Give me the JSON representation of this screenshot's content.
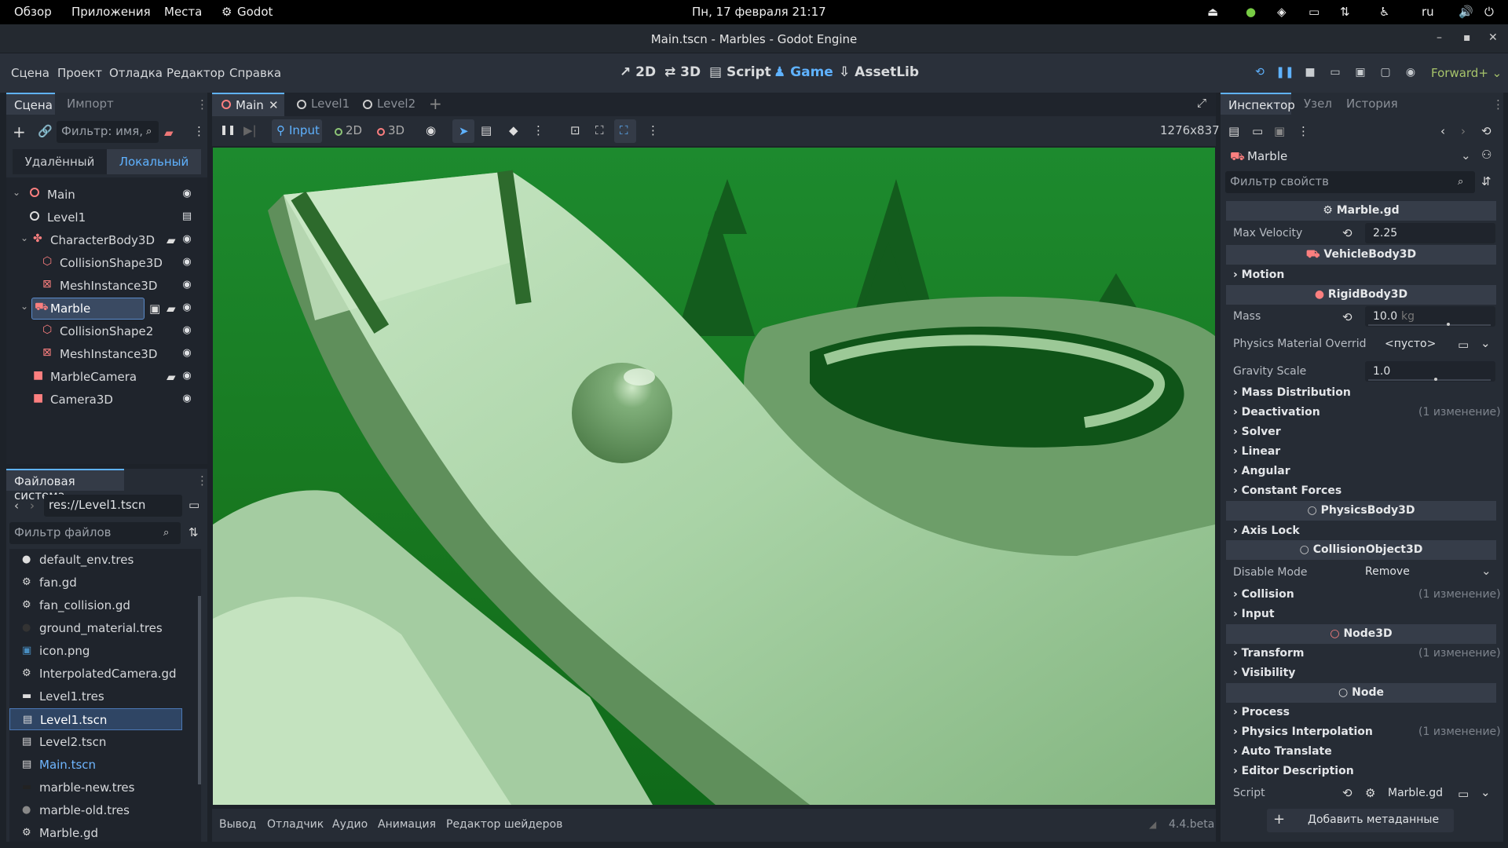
{
  "system_bar": {
    "overview": "Обзор",
    "apps": "Приложения",
    "places": "Места",
    "godot": "Godot",
    "clock": "Пн, 17 февраля  21:17",
    "lang": "ru"
  },
  "window": {
    "title": "Main.tscn - Marbles - Godot Engine"
  },
  "menu": {
    "items": [
      "Сцена",
      "Проект",
      "Отладка",
      "Редактор",
      "Справка"
    ]
  },
  "main_screens": {
    "b2d": "2D",
    "b3d": "3D",
    "script": "Script",
    "game": "Game",
    "assetlib": "AssetLib"
  },
  "renderer": "Forward+",
  "scene_dock": {
    "tabs": [
      "Сцена",
      "Импорт"
    ],
    "filter_placeholder": "Фильтр: имя,",
    "remote": "Удалённый",
    "local": "Локальный",
    "tree": [
      {
        "label": "Main"
      },
      {
        "label": "Level1"
      },
      {
        "label": "CharacterBody3D"
      },
      {
        "label": "CollisionShape3D"
      },
      {
        "label": "MeshInstance3D"
      },
      {
        "label": "Marble"
      },
      {
        "label": "CollisionShape2"
      },
      {
        "label": "MeshInstance3D"
      },
      {
        "label": "MarbleCamera"
      },
      {
        "label": "Camera3D"
      }
    ]
  },
  "filesystem": {
    "tab": "Файловая система",
    "path": "res://Level1.tscn",
    "filter_placeholder": "Фильтр файлов",
    "files": [
      {
        "name": "default_env.tres"
      },
      {
        "name": "fan.gd"
      },
      {
        "name": "fan_collision.gd"
      },
      {
        "name": "ground_material.tres"
      },
      {
        "name": "icon.png"
      },
      {
        "name": "InterpolatedCamera.gd"
      },
      {
        "name": "Level1.tres"
      },
      {
        "name": "Level1.tscn"
      },
      {
        "name": "Level2.tscn"
      },
      {
        "name": "Main.tscn"
      },
      {
        "name": "marble-new.tres"
      },
      {
        "name": "marble-old.tres"
      },
      {
        "name": "Marble.gd"
      }
    ]
  },
  "editor_tabs": {
    "main": "Main",
    "level1": "Level1",
    "level2": "Level2"
  },
  "game_toolbar": {
    "input": "Input",
    "b2d": "2D",
    "b3d": "3D",
    "resolution": "1276x837"
  },
  "bottom_panel": {
    "tabs": [
      "Вывод",
      "Отладчик",
      "Аудио",
      "Анимация",
      "Редактор шейдеров"
    ],
    "version": "4.4.beta"
  },
  "inspector": {
    "tabs": [
      "Инспектор",
      "Узел",
      "История"
    ],
    "object": "Marble",
    "filter_placeholder": "Фильтр свойств",
    "script_section": "Marble.gd",
    "max_velocity_label": "Max Velocity",
    "max_velocity": "2.25",
    "vehicle_section": "VehicleBody3D",
    "motion": "Motion",
    "rigid_section": "RigidBody3D",
    "mass_label": "Mass",
    "mass_value": "10.0",
    "mass_unit": "kg",
    "phys_mat_label": "Physics Material Overrid",
    "phys_mat_value": "<пусто>",
    "gravity_label": "Gravity Scale",
    "gravity_value": "1.0",
    "mass_distribution": "Mass Distribution",
    "deactivation": "Deactivation",
    "change1": "(1 изменение)",
    "solver": "Solver",
    "linear": "Linear",
    "angular": "Angular",
    "constant_forces": "Constant Forces",
    "physicsbody_section": "PhysicsBody3D",
    "axis_lock": "Axis Lock",
    "collisionobject_section": "CollisionObject3D",
    "disable_mode_label": "Disable Mode",
    "disable_mode_value": "Remove",
    "collision": "Collision",
    "input": "Input",
    "node3d_section": "Node3D",
    "transform": "Transform",
    "visibility": "Visibility",
    "node_section": "Node",
    "process": "Process",
    "physics_interp": "Physics Interpolation",
    "auto_translate": "Auto Translate",
    "editor_desc": "Editor Description",
    "script_label": "Script",
    "script_value": "Marble.gd",
    "add_metadata": "Добавить метаданные"
  },
  "colors": {
    "accent": "#5fb2ff",
    "node3d": "#fc7f7f",
    "bg": "#1d2229",
    "panel": "#262c35"
  }
}
